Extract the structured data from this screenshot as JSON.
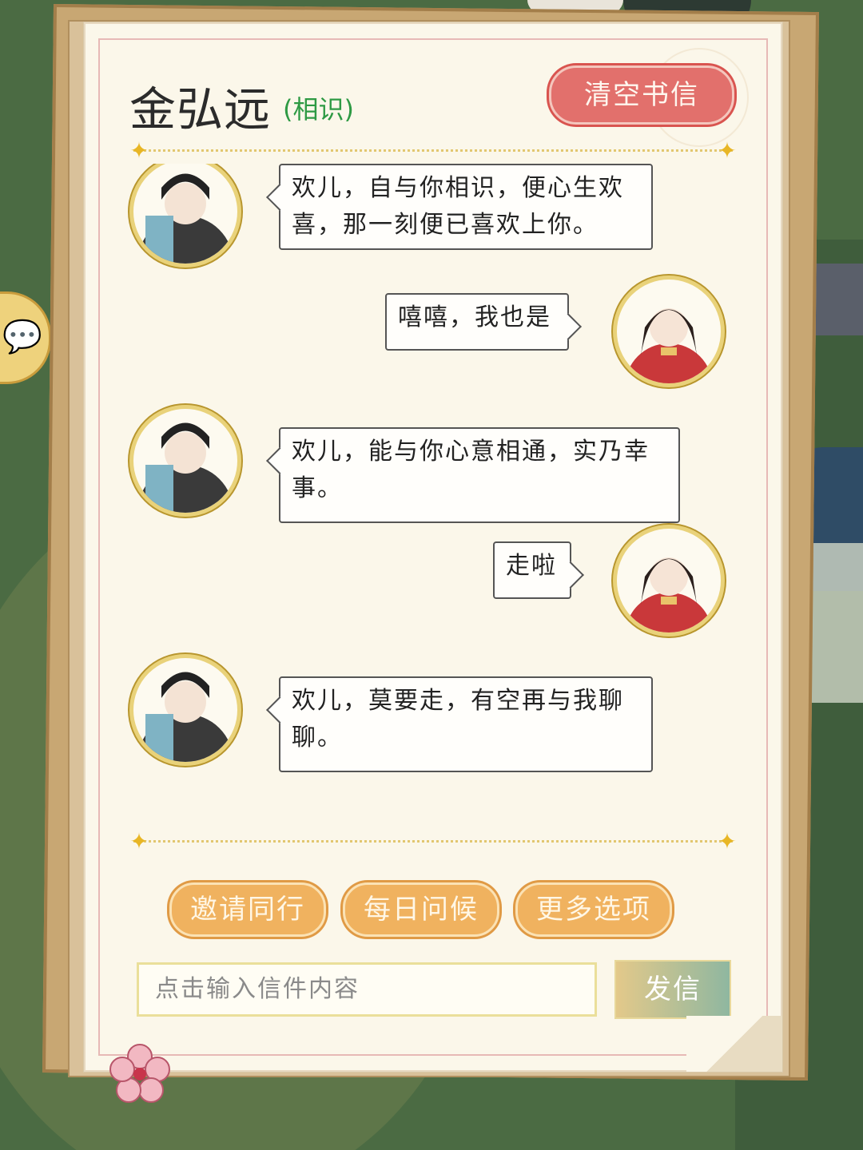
{
  "header": {
    "contact_name": "金弘远",
    "relation": "(相识)",
    "clear_button": "清空书信"
  },
  "messages": [
    {
      "sender": "npc",
      "text": "欢儿，自与你相识，便心生欢喜，那一刻便已喜欢上你。"
    },
    {
      "sender": "player",
      "text": "嘻嘻，我也是"
    },
    {
      "sender": "npc",
      "text": "欢儿，能与你心意相通，实乃幸事。"
    },
    {
      "sender": "player",
      "text": "走啦"
    },
    {
      "sender": "npc",
      "text": "欢儿，莫要走，有空再与我聊聊。"
    }
  ],
  "options": {
    "invite": "邀请同行",
    "greet": "每日问候",
    "more": "更多选项"
  },
  "composer": {
    "placeholder": "点击输入信件内容",
    "send": "发信"
  },
  "colors": {
    "relation": "#2e9a44",
    "clear_button": "#e2706c",
    "option_button": "#f0b25f",
    "divider_star": "#e8b625"
  }
}
